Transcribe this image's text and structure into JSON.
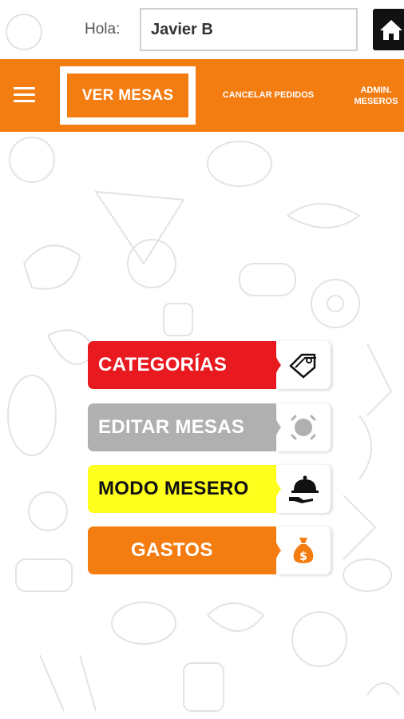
{
  "header": {
    "greeting": "Hola:",
    "user_name": "Javier B"
  },
  "nav": {
    "ver_mesas": "VER MESAS",
    "cancelar_pedidos": "CANCELAR PEDIDOS",
    "admin_line1": "ADMIN.",
    "admin_line2": "MESEROS"
  },
  "menu": {
    "categorias": "CATEGORÍAS",
    "editar_mesas": "EDITAR MESAS",
    "modo_mesero": "MODO MESERO",
    "gastos": "GASTOS"
  },
  "colors": {
    "accent": "#f47d12",
    "categorias": "#e8191f",
    "editar": "#b0b0b0",
    "modo": "#ffff1e"
  },
  "icons": {
    "home": "home-icon",
    "menu": "hamburger-icon",
    "tag": "tag-icon",
    "circle": "circle-target-icon",
    "waiter": "serving-tray-icon",
    "money": "money-bag-icon"
  }
}
